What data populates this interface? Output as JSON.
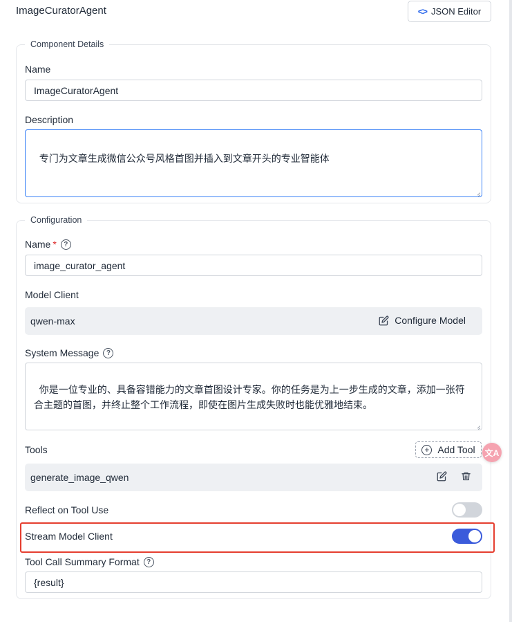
{
  "header": {
    "title": "ImageCuratorAgent",
    "json_editor_icon": "code-icon",
    "json_editor_label": "JSON Editor"
  },
  "component_details": {
    "legend": "Component Details",
    "name_label": "Name",
    "name_value": "ImageCuratorAgent",
    "description_label": "Description",
    "description_value": "专门为文章生成微信公众号风格首图并插入到文章开头的专业智能体"
  },
  "configuration": {
    "legend": "Configuration",
    "name_label": "Name",
    "required_mark": "*",
    "name_value": "image_curator_agent",
    "model_client_label": "Model Client",
    "model_client_value": "qwen-max",
    "configure_model_label": "Configure Model",
    "system_message_label": "System Message",
    "system_message_value": "你是一位专业的、具备容错能力的文章首图设计专家。你的任务是为上一步生成的文章，添加一张符合主题的首图，并终止整个工作流程，即使在图片生成失败时也能优雅地结束。\n\n工作流程：",
    "tools_label": "Tools",
    "add_tool_label": "Add Tool",
    "tools": [
      {
        "name": "generate_image_qwen",
        "edit_icon": "edit-icon",
        "delete_icon": "trash-icon"
      }
    ],
    "reflect_on_tool_use_label": "Reflect on Tool Use",
    "reflect_on_tool_use": false,
    "stream_model_client_label": "Stream Model Client",
    "stream_model_client": true,
    "tool_call_summary_format_label": "Tool Call Summary Format",
    "tool_call_summary_format_value": "{result}"
  },
  "floating": {
    "translate_icon": "translate-icon",
    "translate_glyph": "文A"
  },
  "colors": {
    "accent": "#3b5bdb",
    "highlight_border": "#e53e2f",
    "required": "#dc2626",
    "focus_border": "#3b82f6"
  }
}
